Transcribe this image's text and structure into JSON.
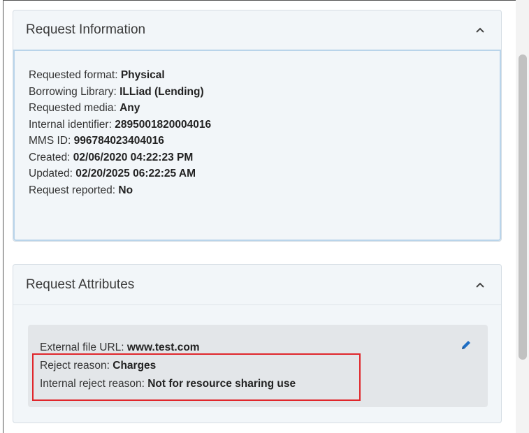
{
  "request_information": {
    "title": "Request Information",
    "fields": [
      {
        "label": "Requested format: ",
        "value": "Physical"
      },
      {
        "label": "Borrowing Library: ",
        "value": "ILLiad (Lending)"
      },
      {
        "label": "Requested media: ",
        "value": "Any"
      },
      {
        "label": "Internal identifier: ",
        "value": "2895001820004016"
      },
      {
        "label": "MMS ID: ",
        "value": "996784023404016"
      },
      {
        "label": "Created: ",
        "value": "02/06/2020 04:22:23 PM"
      },
      {
        "label": "Updated: ",
        "value": "02/20/2025 06:22:25 AM"
      },
      {
        "label": "Request reported: ",
        "value": "No"
      }
    ]
  },
  "request_attributes": {
    "title": "Request Attributes",
    "fields": [
      {
        "label": "External file URL: ",
        "value": "www.test.com"
      },
      {
        "label": "Reject reason: ",
        "value": "Charges"
      },
      {
        "label": "Internal reject reason: ",
        "value": "Not for resource sharing use"
      }
    ]
  },
  "icons": {
    "collapse": "chevron-up-icon",
    "edit": "pencil-icon"
  },
  "colors": {
    "highlight": "#e0262b",
    "edit_icon": "#1f6fc5",
    "info_border": "#b9d4ea"
  }
}
